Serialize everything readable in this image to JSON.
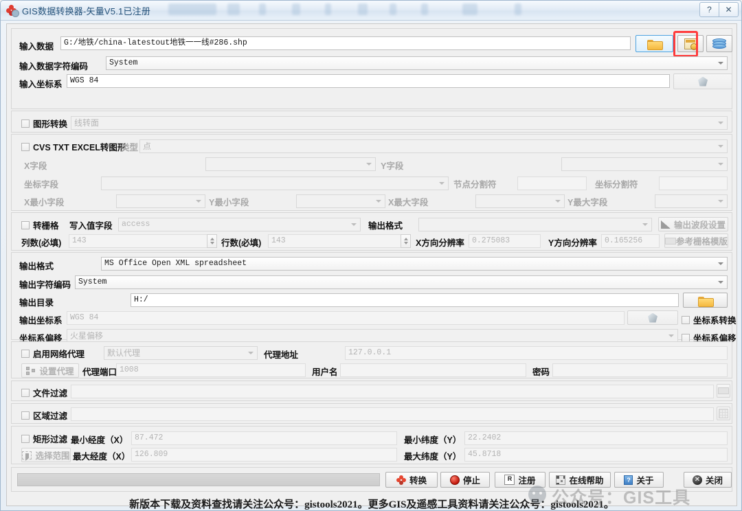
{
  "window": {
    "title": "GIS数据转换器-矢量V5.1已注册",
    "help_btn": "?",
    "close_btn": "✕"
  },
  "input": {
    "data_label": "输入数据",
    "data_value": "G:/地铁/china-latestout地铁一一线#286.shp",
    "browse_folder_title": "浏览文件夹",
    "browse_sheet_title": "打开表格",
    "browse_db_title": "打开数据库",
    "encoding_label": "输入数据字符编码",
    "encoding_value": "System",
    "crs_label": "输入坐标系",
    "crs_value": "WGS 84",
    "crs_btn_title": "选择坐标系"
  },
  "shape_convert": {
    "checkbox_label": "图形转换",
    "value": "线转面"
  },
  "csv_convert": {
    "checkbox_label": "CVS TXT EXCEL转图形",
    "type_label": "类型",
    "type_value": "点",
    "x_field_label": "X字段",
    "x_field_value": "",
    "y_field_label": "Y字段",
    "y_field_value": "",
    "coord_field_label": "坐标字段",
    "coord_field_value": "",
    "node_sep_label": "节点分割符",
    "node_sep_value": "",
    "coord_sep_label": "坐标分割符",
    "coord_sep_value": "",
    "xmin_field_label": "X最小字段",
    "xmin_field_value": "",
    "ymin_field_label": "Y最小字段",
    "ymin_field_value": "",
    "xmax_field_label": "X最大字段",
    "xmax_field_value": "",
    "ymax_field_label": "Y最大字段",
    "ymax_field_value": ""
  },
  "raster": {
    "checkbox_label": "转栅格",
    "value_field_label": "写入值字段",
    "value_field_value": "access",
    "out_format_label": "输出格式",
    "out_format_value": "",
    "band_settings_btn": "输出波段设置",
    "cols_label": "列数(必填)",
    "cols_value": "143",
    "rows_label": "行数(必填)",
    "rows_value": "143",
    "xres_label": "X方向分辨率",
    "xres_value": "0.275083",
    "yres_label": "Y方向分辨率",
    "yres_value": "0.165256",
    "template_btn": "参考栅格模版"
  },
  "output": {
    "format_label": "输出格式",
    "format_value": "MS Office Open XML spreadsheet",
    "encoding_label": "输出字符编码",
    "encoding_value": "System",
    "dir_label": "输出目录",
    "dir_value": "H:/",
    "dir_browse_title": "选择输出目录",
    "crs_label": "输出坐标系",
    "crs_value": "WGS 84",
    "crs_btn_title": "选择坐标系",
    "crs_transform_label": "坐标系转换",
    "offset_label": "坐标系偏移",
    "offset_value": "火星偏移",
    "crs_offset_label": "坐标系偏移"
  },
  "proxy": {
    "enable_label": "启用网络代理",
    "type_value": "默认代理",
    "address_label": "代理地址",
    "address_value": "127.0.0.1",
    "settings_btn": "设置代理",
    "port_label": "代理端口",
    "port_value": "1008",
    "user_label": "用户名",
    "user_value": "",
    "password_label": "密码",
    "password_value": ""
  },
  "filters": {
    "file_filter_label": "文件过滤",
    "file_filter_value": "",
    "area_filter_label": "区域过滤",
    "area_filter_value": "",
    "rect_filter_label": "矩形过滤",
    "select_range_btn": "选择范围",
    "min_lon_label": "最小经度（X）",
    "min_lon_value": "87.472",
    "max_lon_label": "最大经度（X）",
    "max_lon_value": "126.809",
    "min_lat_label": "最小纬度（Y）",
    "min_lat_value": "22.2402",
    "max_lat_label": "最大纬度（Y）",
    "max_lat_value": "45.8718"
  },
  "actions": {
    "convert": "转换",
    "stop": "停止",
    "register": "注册",
    "online_help": "在线帮助",
    "about": "关于",
    "close": "关闭"
  },
  "footer": {
    "note": "新版本下载及资料查找请关注公众号：gistools2021。更多GIS及遥感工具资料请关注公众号：gistools2021。",
    "watermark": "公众号：GIS工具"
  }
}
